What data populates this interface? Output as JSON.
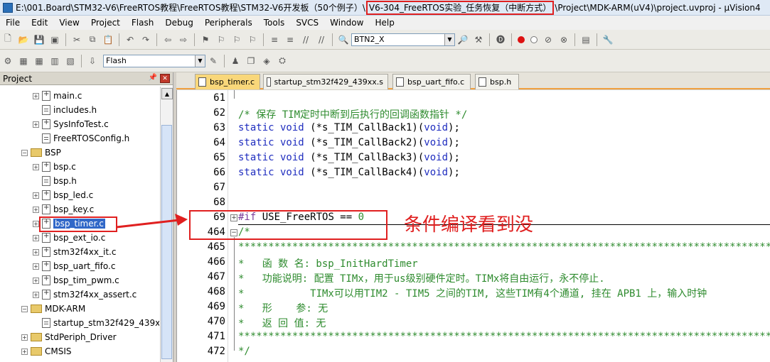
{
  "window": {
    "title_prefix": "E:\\001.Board\\STM32-V6\\FreeRTOS教程\\FreeRTOS教程\\STM32-V6开发板（50个例子）\\",
    "title_highlight": "V6-304_FreeRTOS实验_任务恢复（中断方式）",
    "title_suffix": "\\Project\\MDK-ARM(uV4)\\project.uvproj - µVision4"
  },
  "menu": [
    "File",
    "Edit",
    "View",
    "Project",
    "Flash",
    "Debug",
    "Peripherals",
    "Tools",
    "SVCS",
    "Window",
    "Help"
  ],
  "toolbar": {
    "find_combo_value": "BTN2_X",
    "target_combo_value": "Flash"
  },
  "project": {
    "header": "Project",
    "tree": [
      {
        "label": "main.c",
        "kind": "c"
      },
      {
        "label": "includes.h",
        "kind": "h"
      },
      {
        "label": "SysInfoTest.c",
        "kind": "c"
      },
      {
        "label": "FreeRTOSConfig.h",
        "kind": "h"
      },
      {
        "label": "BSP",
        "kind": "folder"
      },
      {
        "label": "bsp.c",
        "kind": "c"
      },
      {
        "label": "bsp.h",
        "kind": "h"
      },
      {
        "label": "bsp_led.c",
        "kind": "c"
      },
      {
        "label": "bsp_key.c",
        "kind": "c"
      },
      {
        "label": "bsp_timer.c",
        "kind": "c",
        "selected": true
      },
      {
        "label": "bsp_ext_io.c",
        "kind": "c"
      },
      {
        "label": "stm32f4xx_it.c",
        "kind": "c"
      },
      {
        "label": "bsp_uart_fifo.c",
        "kind": "c"
      },
      {
        "label": "bsp_tim_pwm.c",
        "kind": "c"
      },
      {
        "label": "stm32f4xx_assert.c",
        "kind": "c"
      },
      {
        "label": "MDK-ARM",
        "kind": "folder"
      },
      {
        "label": "startup_stm32f429_439x",
        "kind": "s"
      },
      {
        "label": "StdPeriph_Driver",
        "kind": "folder"
      },
      {
        "label": "CMSIS",
        "kind": "folder"
      }
    ]
  },
  "tabs": [
    {
      "label": "bsp_timer.c",
      "active": true
    },
    {
      "label": "startup_stm32f429_439xx.s",
      "active": false
    },
    {
      "label": "bsp_uart_fifo.c",
      "active": false
    },
    {
      "label": "bsp.h",
      "active": false
    }
  ],
  "code_lines": [
    {
      "num": "61",
      "text": ""
    },
    {
      "num": "62",
      "text": "/* 保存 TIM定时中断到后执行的回调函数指针 */"
    },
    {
      "num": "63",
      "kw1": "static void",
      "rest": " (*s_TIM_CallBack1)(",
      "kw2": "void",
      "end": ");"
    },
    {
      "num": "64",
      "kw1": "static void",
      "rest": " (*s_TIM_CallBack2)(",
      "kw2": "void",
      "end": ");"
    },
    {
      "num": "65",
      "kw1": "static void",
      "rest": " (*s_TIM_CallBack3)(",
      "kw2": "void",
      "end": ");"
    },
    {
      "num": "66",
      "kw1": "static void",
      "rest": " (*s_TIM_CallBack4)(",
      "kw2": "void",
      "end": ");"
    },
    {
      "num": "67",
      "text": ""
    },
    {
      "num": "68",
      "text": ""
    },
    {
      "num": "69",
      "pp": "#if",
      "rest": " USE_FreeRTOS == ",
      "numv": "0"
    },
    {
      "num": "464",
      "text": "/*"
    },
    {
      "num": "465",
      "text": "*********************************************************************************************************"
    },
    {
      "num": "466",
      "text": "*   函 数 名: bsp_InitHardTimer"
    },
    {
      "num": "467",
      "text": "*   功能说明: 配置 TIMx，用于us级别硬件定时。TIMx将自由运行，永不停止."
    },
    {
      "num": "468",
      "text": "*           TIMx可以用TIM2 - TIM5 之间的TIM, 这些TIM有4个通道, 挂在 APB1 上，输入时钟"
    },
    {
      "num": "469",
      "text": "*   形    参: 无"
    },
    {
      "num": "470",
      "text": "*   返 回 值: 无"
    },
    {
      "num": "471",
      "text": "*********************************************************************************************************"
    },
    {
      "num": "472",
      "text": "*/"
    }
  ],
  "annotation": {
    "text": "条件编译看到没"
  },
  "colors": {
    "annotation": "#e02020",
    "comment": "#2e8b2e",
    "keyword": "#1f2dbf",
    "selection": "#3168c8",
    "active_tab": "#f9d77a"
  }
}
